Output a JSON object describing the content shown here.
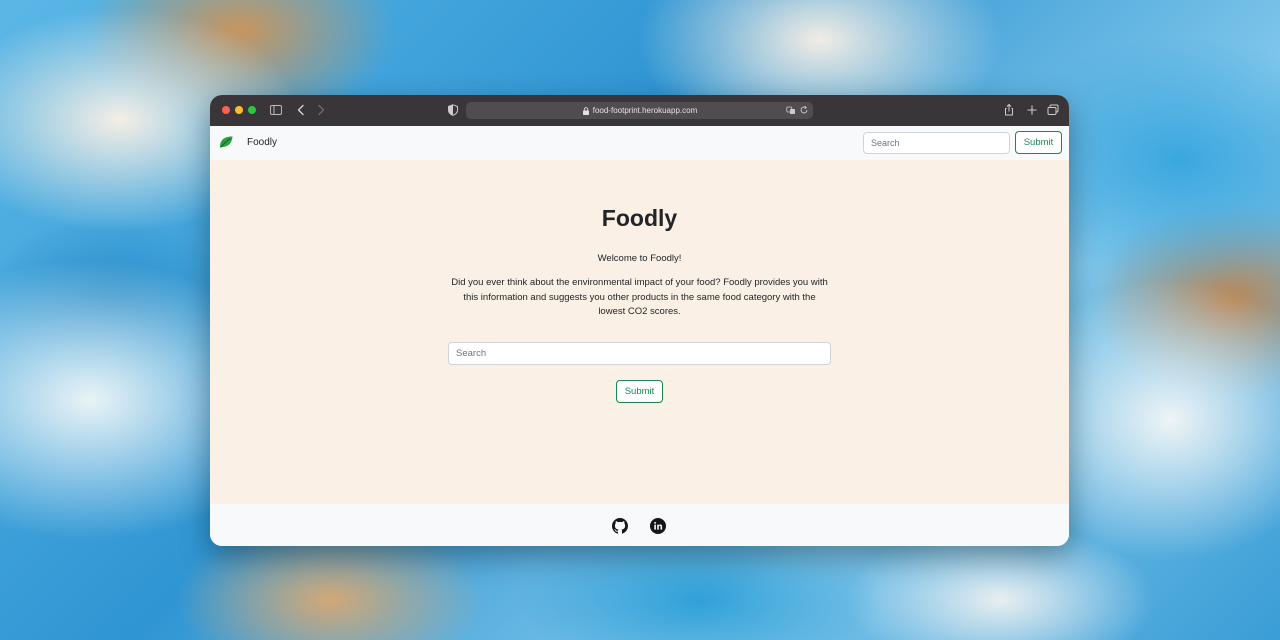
{
  "browser": {
    "url": "food-footprint.herokuapp.com"
  },
  "navbar": {
    "brand": "Foodly",
    "search_placeholder": "Search",
    "submit_label": "Submit"
  },
  "hero": {
    "title": "Foodly",
    "welcome": "Welcome to Foodly!",
    "description": "Did you ever think about the environmental impact of your food? Foodly provides you with this information and suggests you other products in the same food category with the lowest CO2 scores.",
    "search_placeholder": "Search",
    "submit_label": "Submit"
  },
  "footer": {
    "icons": [
      "github-icon",
      "linkedin-icon"
    ]
  },
  "colors": {
    "accent_green": "#198754",
    "main_background": "#faf0e6",
    "navbar_background": "#f8f9fa"
  }
}
